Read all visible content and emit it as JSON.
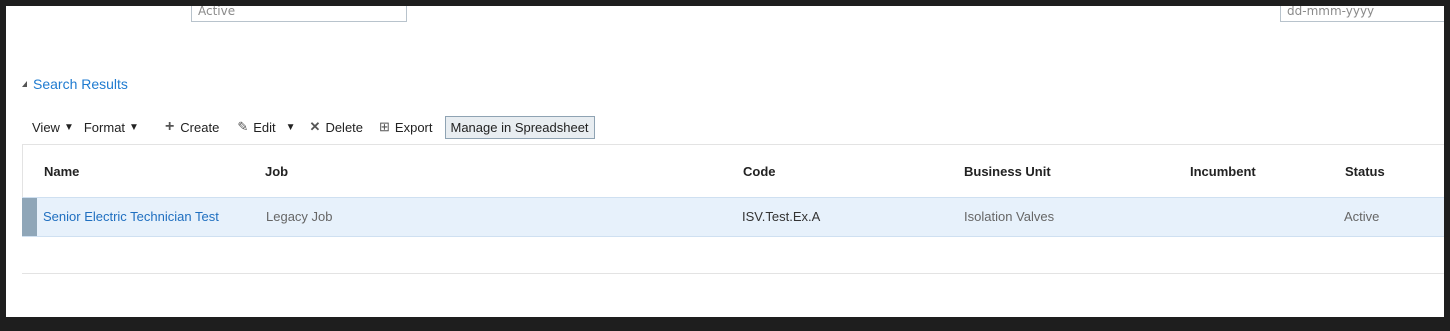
{
  "top_inputs": {
    "left_value": "Active",
    "right_placeholder": "dd-mmm-yyyy"
  },
  "section": {
    "title": "Search Results"
  },
  "toolbar": {
    "view": "View",
    "format": "Format",
    "create": "Create",
    "edit": "Edit",
    "delete": "Delete",
    "export": "Export",
    "manage": "Manage in Spreadsheet"
  },
  "table": {
    "columns": [
      "Name",
      "Job",
      "Code",
      "Business Unit",
      "Incumbent",
      "Status"
    ],
    "rows": [
      {
        "name": "Senior Electric Technician Test",
        "job": "Legacy Job",
        "code": "ISV.Test.Ex.A",
        "business_unit": "Isolation Valves",
        "incumbent": "",
        "status": "Active"
      }
    ]
  },
  "colors": {
    "link": "#1f6fc0",
    "row_selected": "#e7f1fb",
    "row_marker": "#8fa6b8"
  }
}
